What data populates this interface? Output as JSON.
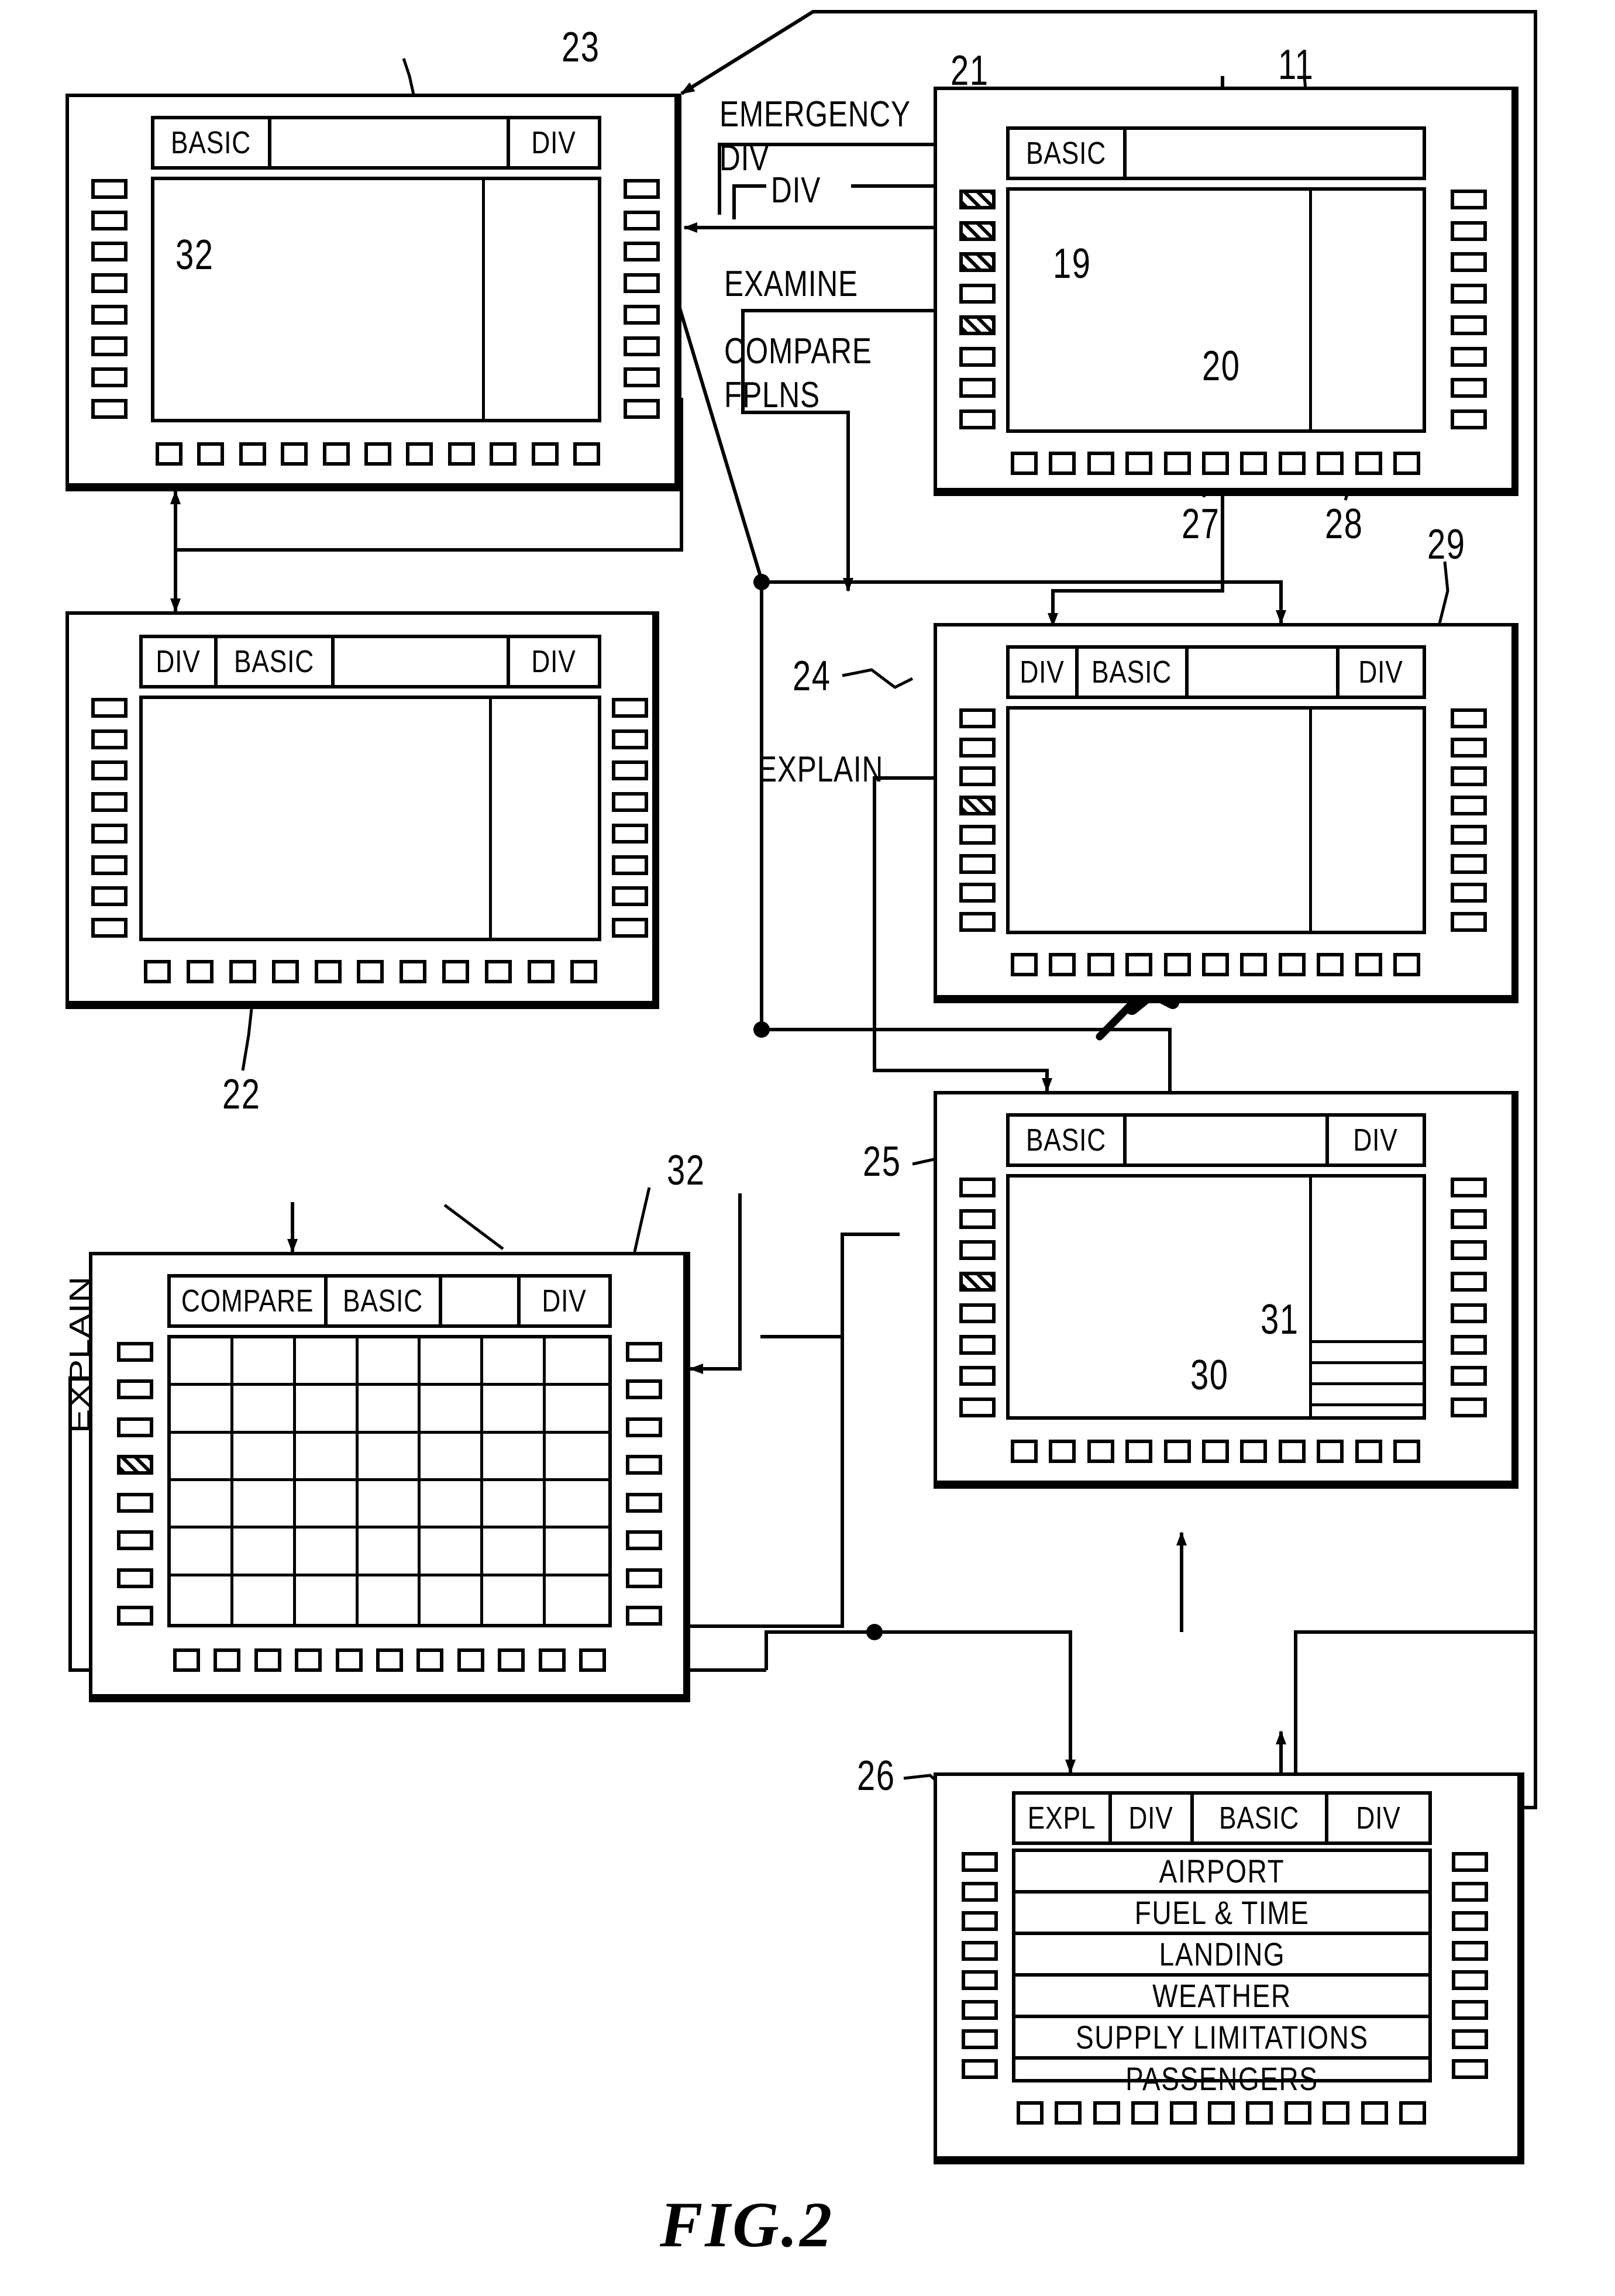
{
  "figure": {
    "caption": "FIG.2"
  },
  "callouts": {
    "emergency_div": "EMERGENCY\nDIV",
    "emergency_div_line1": "EMERGENCY",
    "emergency_div_line2": "DIV",
    "div": "DIV",
    "examine": "EXAMINE",
    "compare_fplns_line1": "COMPARE",
    "compare_fplns_line2": "FPLNS",
    "explain_unit24": "EXPLAIN",
    "explain_unit32": "EXPLAIN"
  },
  "numerals": {
    "n11": "11",
    "n19": "19",
    "n20": "20",
    "n21": "21",
    "n22": "22",
    "n23": "23",
    "n24": "24",
    "n25": "25",
    "n26": "26",
    "n27": "27",
    "n28": "28",
    "n29": "29",
    "n30": "30",
    "n31": "31",
    "n32_top": "32",
    "n32_bottom": "32"
  },
  "units": [
    {
      "id": "unit-23",
      "ref": "23",
      "title_cells": [
        "BASIC",
        "",
        "DIV"
      ],
      "map_label": "32",
      "left_bezel_count": 8,
      "right_bezel_count": 8,
      "bottom_bezel_count": 11,
      "left_hatched": [],
      "content_type": "map"
    },
    {
      "id": "unit-11",
      "ref": "11",
      "title_cells": [
        "BASIC",
        ""
      ],
      "map_labels": [
        "19",
        "20"
      ],
      "left_bezel_count": 8,
      "right_bezel_count": 8,
      "bottom_bezel_count": 11,
      "left_hatched": [
        0,
        1,
        2,
        4
      ],
      "content_type": "map"
    },
    {
      "id": "unit-22",
      "ref": "22",
      "title_cells": [
        "DIV",
        "BASIC",
        "",
        "DIV"
      ],
      "left_bezel_count": 8,
      "right_bezel_count": 8,
      "bottom_bezel_count": 11,
      "left_hatched": [],
      "content_type": "map"
    },
    {
      "id": "unit-29",
      "ref": "29",
      "title_cells": [
        "DIV",
        "BASIC",
        "",
        "DIV"
      ],
      "left_bezel_count": 8,
      "right_bezel_count": 8,
      "bottom_bezel_count": 11,
      "left_hatched": [
        3
      ],
      "content_type": "map"
    },
    {
      "id": "unit-25",
      "ref": "25",
      "title_cells": [
        "BASIC",
        "",
        "DIV"
      ],
      "map_labels": [
        "30",
        "31"
      ],
      "left_bezel_count": 8,
      "right_bezel_count": 8,
      "bottom_bezel_count": 11,
      "left_hatched": [
        3
      ],
      "content_type": "map-with-bands"
    },
    {
      "id": "unit-32",
      "ref": "32",
      "title_cells": [
        "COMPARE",
        "BASIC",
        "",
        "DIV"
      ],
      "left_bezel_count": 8,
      "right_bezel_count": 8,
      "bottom_bezel_count": 11,
      "left_hatched": [
        3
      ],
      "content_type": "table",
      "table": {
        "columns": 7,
        "rows": 6
      }
    },
    {
      "id": "unit-26",
      "ref": "26",
      "title_cells": [
        "EXPL",
        "DIV",
        "BASIC",
        "DIV"
      ],
      "left_bezel_count": 8,
      "right_bezel_count": 8,
      "bottom_bezel_count": 11,
      "left_hatched": [],
      "content_type": "list",
      "list_items": [
        "AIRPORT",
        "FUEL  &  TIME",
        "LANDING",
        "WEATHER",
        "SUPPLY  LIMITATIONS",
        "PASSENGERS"
      ]
    }
  ],
  "colors": {
    "ink": "#000000",
    "paper": "#ffffff"
  }
}
